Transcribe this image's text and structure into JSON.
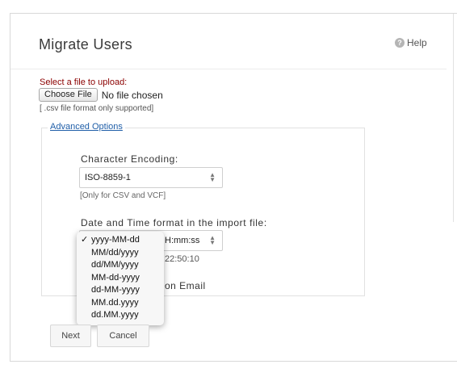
{
  "header": {
    "title": "Migrate Users",
    "help_label": "Help",
    "help_icon": "question-circle-icon"
  },
  "upload": {
    "label": "Select a file to upload:",
    "choose_button": "Choose File",
    "file_status": "No file chosen",
    "format_note": "[ .csv file format only supported]"
  },
  "advanced": {
    "legend": "Advanced Options",
    "encoding": {
      "label": "Character Encoding:",
      "value": "ISO-8859-1",
      "hint": "[Only for CSV and VCF]"
    },
    "datetime": {
      "label": "Date and Time format in the import file:",
      "value_suffix": "H:mm:ss",
      "example_suffix": "22:50:10",
      "options": [
        "yyyy-MM-dd",
        "MM/dd/yyyy",
        "dd/MM/yyyy",
        "MM-dd-yyyy",
        "dd-MM-yyyy",
        "MM.dd.yyyy",
        "dd.MM.yyyy"
      ],
      "selected_index": 0
    },
    "email_option_suffix": "on Email"
  },
  "buttons": {
    "next": "Next",
    "cancel": "Cancel"
  },
  "colors": {
    "upload_label": "#8b0000",
    "link": "#1f5ea8"
  }
}
